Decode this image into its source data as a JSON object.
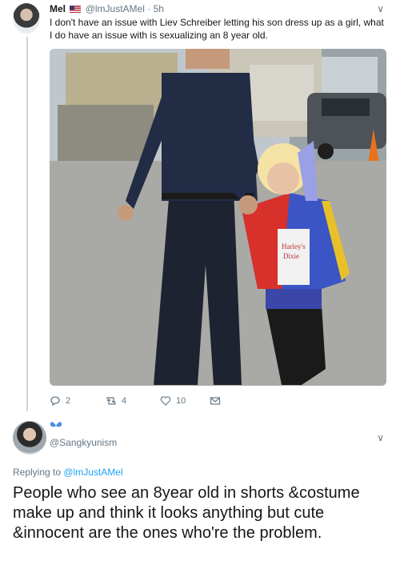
{
  "tweet1": {
    "display_name": "Mel",
    "handle": "@lmJustAMel",
    "time": "· 5h",
    "text": "I don't have an issue with Liev Schreiber letting his son dress up as a girl, what I do have an issue with is sexualizing an 8 year old.",
    "photo_signs": {
      "sign1": "Harley's",
      "sign2": "Dixie"
    },
    "actions": {
      "replies": "2",
      "retweets": "4",
      "likes": "10"
    }
  },
  "tweet2": {
    "handle": "@Sangkyunism",
    "replying_prefix": "Replying to",
    "replying_to": "@lmJustAMel",
    "text": "People who see an 8year old in shorts &costume make up and think it looks anything but cute &innocent are the ones who're the problem."
  },
  "icons": {
    "menu": "chevron-down-icon",
    "reply": "reply-icon",
    "retweet": "retweet-icon",
    "like": "heart-icon",
    "dm": "envelope-icon",
    "badge": "butterfly-icon",
    "flag": "us-flag-icon"
  },
  "colors": {
    "link": "#1da1f2",
    "muted": "#657786",
    "text": "#14171a",
    "thread_line": "#ccd6dd"
  }
}
